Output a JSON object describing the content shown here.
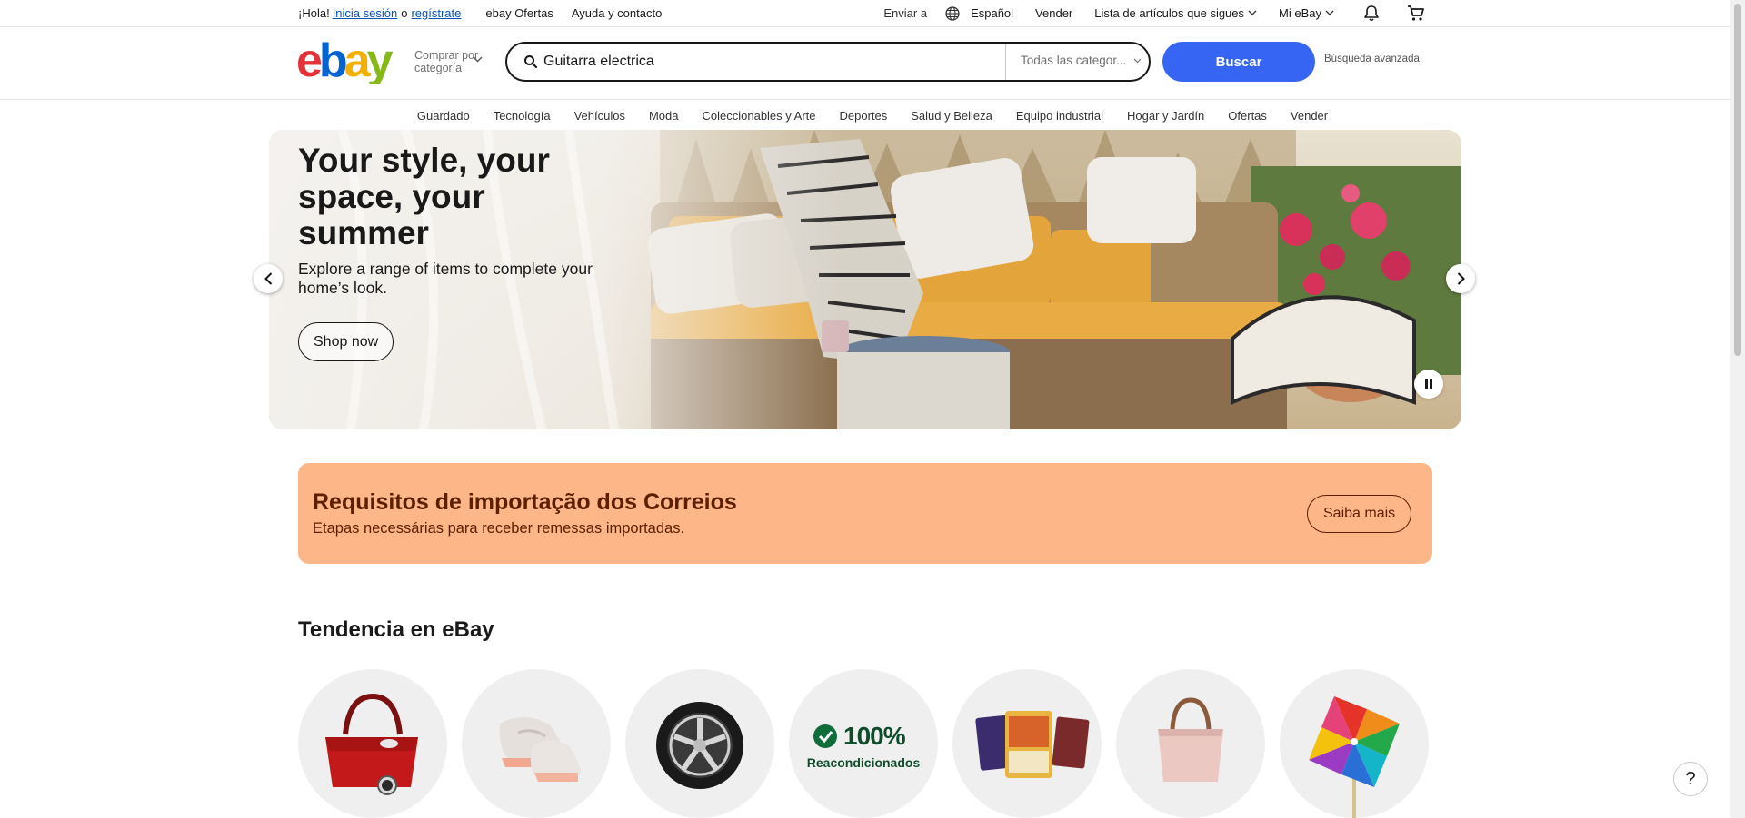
{
  "topbar": {
    "greeting": "¡Hola!",
    "signin": "Inicia sesión",
    "or": "o",
    "register": "regístrate",
    "deals": "ebay Ofertas",
    "help": "Ayuda y contacto",
    "ship_to": "Enviar a",
    "language": "Español",
    "sell": "Vender",
    "watchlist": "Lista de artículos que sigues",
    "my_ebay": "Mi eBay"
  },
  "header": {
    "logo_text": "ebay",
    "shop_by_category_line1": "Comprar por",
    "shop_by_category_line2": "categoría",
    "search_value": "Guitarra electrica",
    "category_select": "Todas las categor...",
    "search_button": "Buscar",
    "advanced_search": "Búsqueda avanzada",
    "logo_colors": [
      "#e53238",
      "#0064d2",
      "#f5af02",
      "#86b817"
    ],
    "accent": "#3665f3"
  },
  "nav": {
    "items": [
      "Guardado",
      "Tecnología",
      "Vehículos",
      "Moda",
      "Coleccionables y Arte",
      "Deportes",
      "Salud y Belleza",
      "Equipo industrial",
      "Hogar y Jardín",
      "Ofertas",
      "Vender"
    ]
  },
  "hero": {
    "title": "Your style, your space, your summer",
    "subtitle": "Explore a range of items to complete your home’s look.",
    "cta": "Shop now"
  },
  "banner": {
    "title": "Requisitos de importação dos Correios",
    "subtitle": "Etapas necessárias para receber remessas importadas.",
    "cta": "Saiba mais",
    "bg_color": "#fdb687"
  },
  "trending": {
    "title": "Tendencia en eBay",
    "refurb_percent": "100%",
    "refurb_label": "Reacondicionados",
    "items": [
      "handbag-watch-image",
      "sneakers-image",
      "car-wheel-image",
      "refurbished-badge",
      "trading-cards-image",
      "pink-tote-image",
      "pinwheel-image"
    ]
  },
  "help": {
    "label": "?"
  }
}
